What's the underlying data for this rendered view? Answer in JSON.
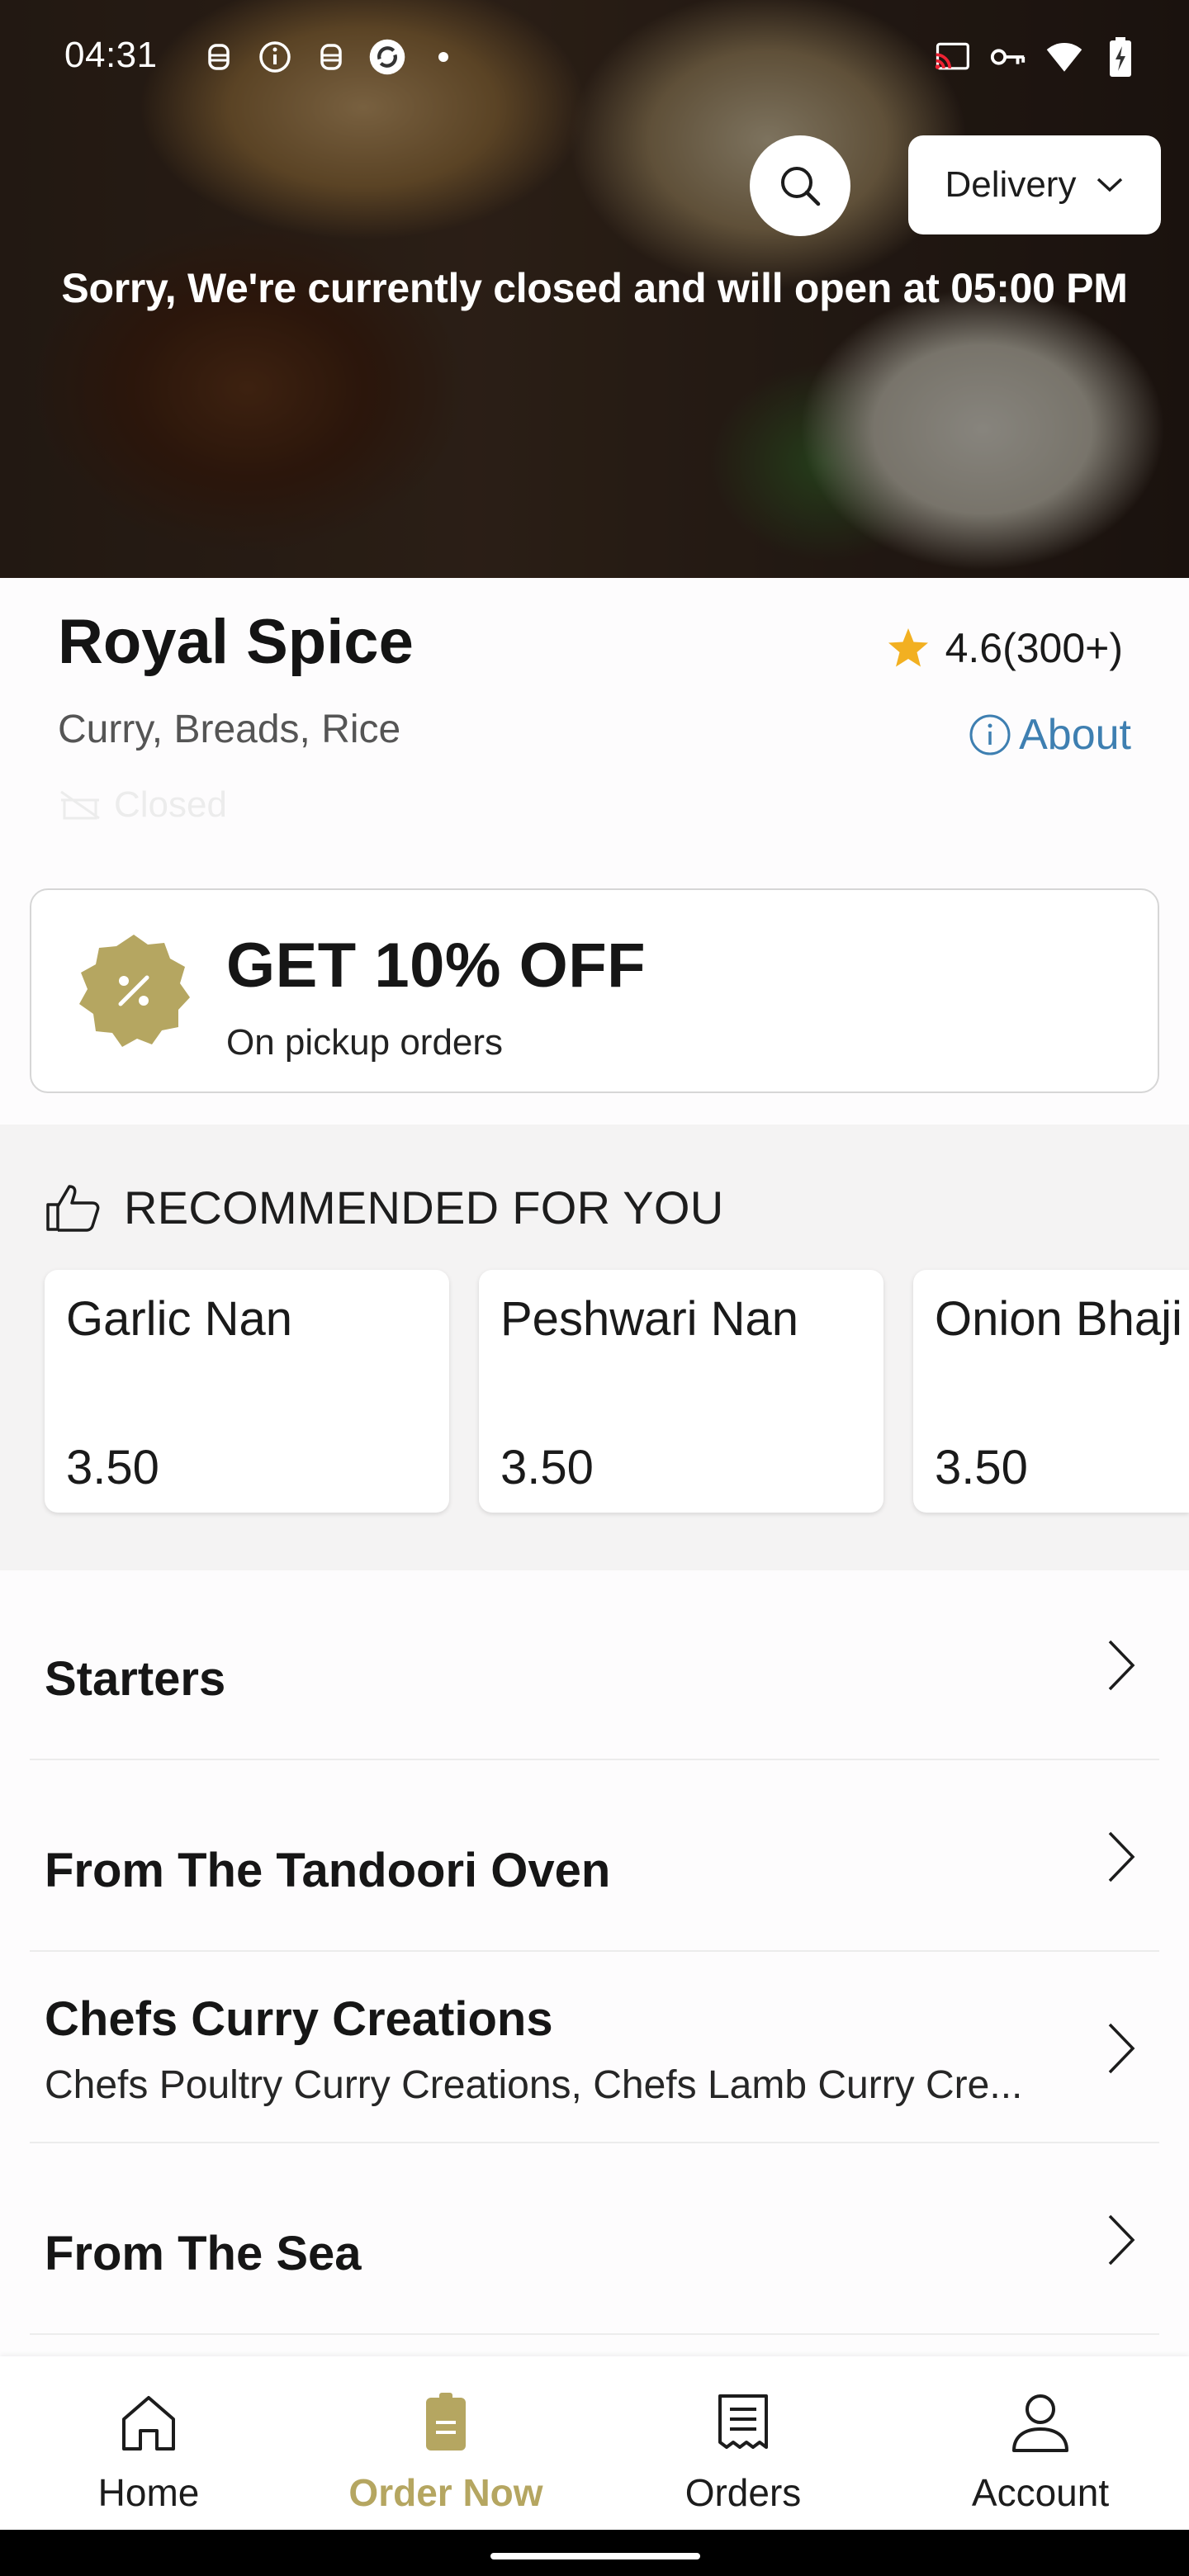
{
  "status_bar": {
    "time": "04:31"
  },
  "hero": {
    "delivery_mode": "Delivery",
    "closed_message": "Sorry, We're currently closed and will open at 05:00 PM"
  },
  "restaurant": {
    "name": "Royal Spice",
    "rating": "4.6(300+)",
    "cuisines": "Curry, Breads, Rice",
    "about_label": "About",
    "status": "Closed"
  },
  "promo": {
    "title": "GET 10% OFF",
    "subtitle": "On pickup orders"
  },
  "recommended": {
    "title": "RECOMMENDED FOR YOU",
    "items": [
      {
        "name": "Garlic Nan",
        "price": "3.50"
      },
      {
        "name": "Peshwari Nan",
        "price": "3.50"
      },
      {
        "name": "Onion Bhaji",
        "price": "3.50"
      }
    ]
  },
  "categories": [
    {
      "title": "Starters",
      "subtitle": ""
    },
    {
      "title": "From The Tandoori Oven",
      "subtitle": ""
    },
    {
      "title": "Chefs Curry Creations",
      "subtitle": "Chefs Poultry Curry Creations, Chefs Lamb Curry Cre..."
    },
    {
      "title": "From The Sea",
      "subtitle": ""
    }
  ],
  "bottom_nav": {
    "items": [
      {
        "label": "Home",
        "icon": "home-icon"
      },
      {
        "label": "Order Now",
        "icon": "order-icon",
        "active": true
      },
      {
        "label": "Orders",
        "icon": "receipt-icon"
      },
      {
        "label": "Account",
        "icon": "person-icon"
      }
    ]
  },
  "colors": {
    "accent_gold": "#b5a661",
    "link_blue": "#3e7fb1",
    "star": "#f2b021"
  }
}
